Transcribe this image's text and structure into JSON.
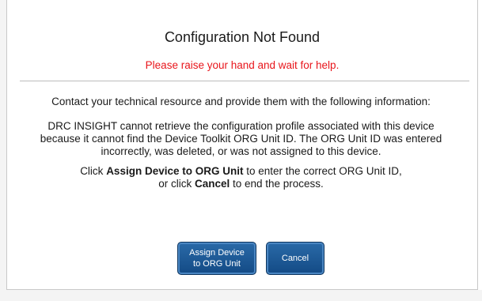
{
  "dialog": {
    "title": "Configuration Not Found",
    "subtitle": "Please raise your hand and wait for help.",
    "paragraph1": "Contact your technical resource and provide them with the following information:",
    "paragraph2": "DRC INSIGHT cannot retrieve the configuration profile associated with this device because it cannot find the Device Toolkit ORG Unit ID. The ORG Unit ID was entered incorrectly, was deleted, or was not assigned to this device.",
    "paragraph3": {
      "part1": "Click ",
      "bold1": "Assign Device to ORG Unit",
      "part2": " to enter the correct ORG Unit ID,",
      "part3": "or click ",
      "bold2": "Cancel",
      "part4": " to end the process."
    }
  },
  "buttons": {
    "assign_label": "Assign Device\nto ORG Unit",
    "cancel_label": "Cancel"
  },
  "colors": {
    "subtitle": "#e8151b",
    "button": "#1c5a97"
  }
}
